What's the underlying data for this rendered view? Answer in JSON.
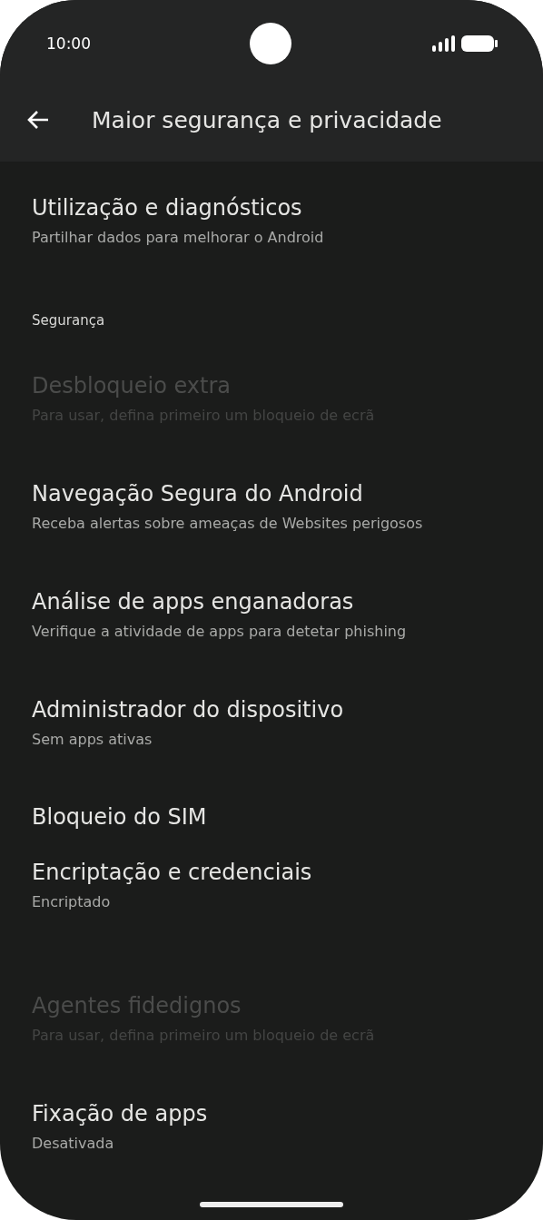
{
  "status_bar": {
    "time": "10:00"
  },
  "app_bar": {
    "title": "Maior segurança e privacidade"
  },
  "sections": [
    {
      "items": [
        {
          "title": "Utilização e diagnósticos",
          "subtitle": "Partilhar dados para melhorar o Android",
          "disabled": false
        }
      ]
    },
    {
      "header": "Segurança",
      "items": [
        {
          "title": "Desbloqueio extra",
          "subtitle": "Para usar, defina primeiro um bloqueio de ecrã",
          "disabled": true
        },
        {
          "title": "Navegação Segura do Android",
          "subtitle": "Receba alertas sobre ameaças de Websites perigosos",
          "disabled": false
        },
        {
          "title": "Análise de apps enganadoras",
          "subtitle": "Verifique a atividade de apps para detetar phishing",
          "disabled": false
        },
        {
          "title": "Administrador do dispositivo",
          "subtitle": "Sem apps ativas",
          "disabled": false
        },
        {
          "title": "Bloqueio do SIM",
          "disabled": false
        },
        {
          "title": "Encriptação e credenciais",
          "subtitle": "Encriptado",
          "disabled": false
        }
      ]
    },
    {
      "items": [
        {
          "title": "Agentes fidedignos",
          "subtitle": "Para usar, defina primeiro um bloqueio de ecrã",
          "disabled": true
        },
        {
          "title": "Fixação de apps",
          "subtitle": "Desativada",
          "disabled": false
        }
      ]
    }
  ]
}
